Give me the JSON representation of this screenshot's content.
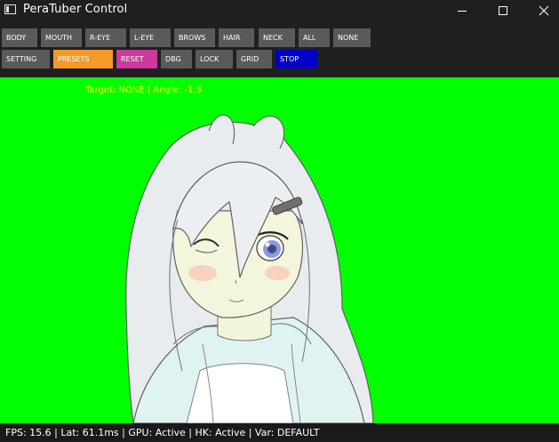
{
  "window": {
    "title": "PeraTuber Control",
    "controls": {
      "minimize": "minimize-icon",
      "maximize": "maximize-icon",
      "close": "close-icon"
    }
  },
  "toolbar": {
    "row1": [
      "BODY",
      "MOUTH",
      "R-EYE",
      "L-EYE",
      "BROWS",
      "HAIR",
      "NECK",
      "ALL",
      "NONE"
    ],
    "row2": [
      "SETTING",
      "PRESETS",
      "RESET",
      "DBG",
      "LOCK",
      "GRID",
      "STOP"
    ]
  },
  "canvas": {
    "target_info": "Target: NONE | Angle: -1.3",
    "background_color": "#00ff00"
  },
  "status": {
    "text": "FPS: 15.6 | Lat: 61.1ms | GPU: Active | HK: Active | Var: DEFAULT"
  },
  "colors": {
    "button": "#5a5a5a",
    "presets": "#f39a28",
    "reset": "#cc3a9d",
    "stop": "#0000c8",
    "target_text": "#ffff00"
  }
}
